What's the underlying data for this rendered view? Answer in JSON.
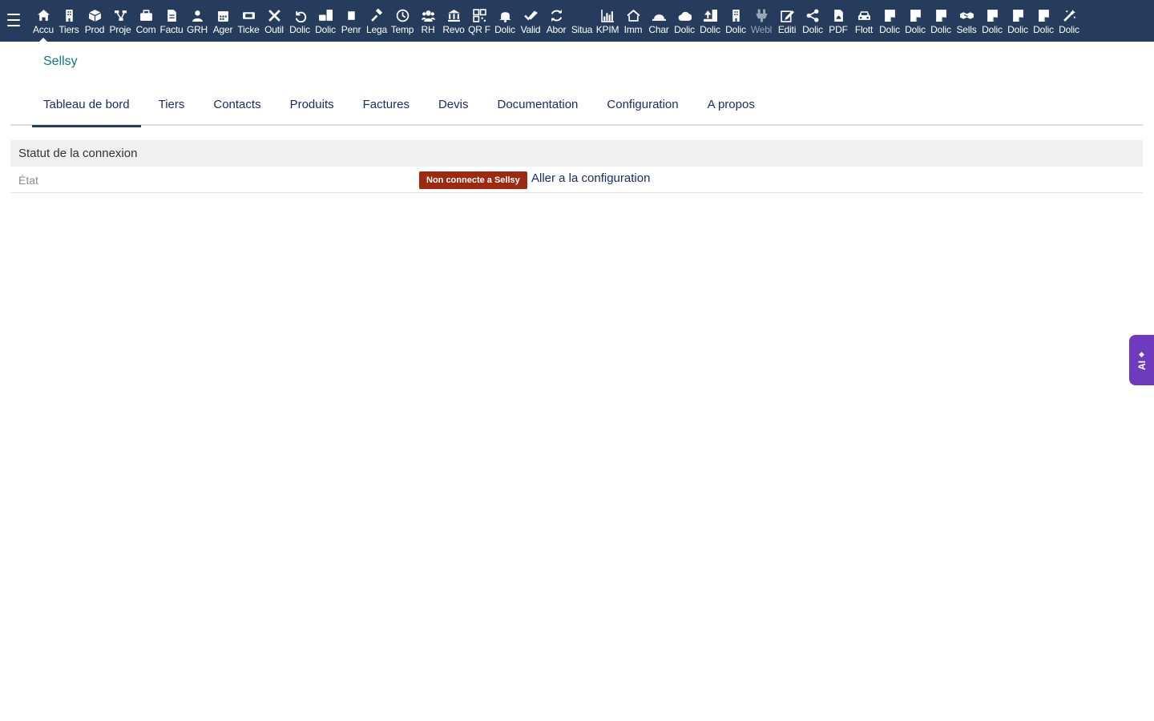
{
  "topbar": {
    "menu_items": [
      {
        "label": "Accu",
        "icon": "home-icon"
      },
      {
        "label": "Tiers",
        "icon": "building-icon"
      },
      {
        "label": "Prod",
        "icon": "cube-icon"
      },
      {
        "label": "Proje",
        "icon": "project-icon"
      },
      {
        "label": "Com",
        "icon": "briefcase-icon"
      },
      {
        "label": "Factu",
        "icon": "invoice-icon"
      },
      {
        "label": "GRH",
        "icon": "person-icon"
      },
      {
        "label": "Ager",
        "icon": "calendar-icon"
      },
      {
        "label": "Ticke",
        "icon": "ticket-icon"
      },
      {
        "label": "Outil",
        "icon": "tools-icon"
      },
      {
        "label": "Dolic",
        "icon": "undo-icon"
      },
      {
        "label": "Dolic",
        "icon": "case-doc-icon"
      },
      {
        "label": "Penr",
        "icon": "note-icon"
      },
      {
        "label": "Lega",
        "icon": "gavel-icon"
      },
      {
        "label": "Temp",
        "icon": "clock-icon"
      },
      {
        "label": "RH",
        "icon": "users-icon"
      },
      {
        "label": "Revo",
        "icon": "bank-icon"
      },
      {
        "label": "QR F",
        "icon": "qrcode-icon"
      },
      {
        "label": "Dolic",
        "icon": "bell-icon"
      },
      {
        "label": "Valid",
        "icon": "double-check-icon"
      },
      {
        "label": "Abor",
        "icon": "sync-icon"
      },
      {
        "label": "Situa",
        "icon": "blank-icon"
      },
      {
        "label": "KPIM",
        "icon": "chart-icon"
      },
      {
        "label": "Imm",
        "icon": "house-icon"
      },
      {
        "label": "Char",
        "icon": "hardhat-icon"
      },
      {
        "label": "Dolic",
        "icon": "cloud-icon"
      },
      {
        "label": "Dolic",
        "icon": "upload-icon"
      },
      {
        "label": "Dolic",
        "icon": "building-icon"
      },
      {
        "label": "Webl",
        "icon": "plug-icon"
      },
      {
        "label": "Editi",
        "icon": "edit-icon"
      },
      {
        "label": "Dolic",
        "icon": "share-icon"
      },
      {
        "label": "PDF",
        "icon": "pdf-icon"
      },
      {
        "label": "Flott",
        "icon": "car-icon"
      },
      {
        "label": "Dolic",
        "icon": "sticky-note-icon"
      },
      {
        "label": "Dolic",
        "icon": "sticky-note-icon"
      },
      {
        "label": "Dolic",
        "icon": "sticky-note-icon"
      },
      {
        "label": "Sells",
        "icon": "handshake-icon"
      },
      {
        "label": "Dolic",
        "icon": "sticky-note-icon"
      },
      {
        "label": "Dolic",
        "icon": "sticky-note-icon"
      },
      {
        "label": "Dolic",
        "icon": "sticky-note-icon"
      },
      {
        "label": "Dolic",
        "icon": "magic-wand-icon"
      }
    ]
  },
  "page": {
    "module_title": "Sellsy"
  },
  "tabs": [
    {
      "label": "Tableau de bord"
    },
    {
      "label": "Tiers"
    },
    {
      "label": "Contacts"
    },
    {
      "label": "Produits"
    },
    {
      "label": "Factures"
    },
    {
      "label": "Devis"
    },
    {
      "label": "Documentation"
    },
    {
      "label": "Configuration"
    },
    {
      "label": "A propos"
    }
  ],
  "connection": {
    "section_title": "Statut de la connexion",
    "state_label": "État",
    "status_badge": "Non connecte a Sellsy",
    "config_link": "Aller a la configuration"
  },
  "ai_assistant": {
    "label": "AI",
    "spark": "◆"
  },
  "colors": {
    "topbar": "#263c5c",
    "module_title": "#0a7b83",
    "link": "#1b2b6a",
    "badge_error": "#9b2a11",
    "ai_tab": "#6e3bbf"
  }
}
